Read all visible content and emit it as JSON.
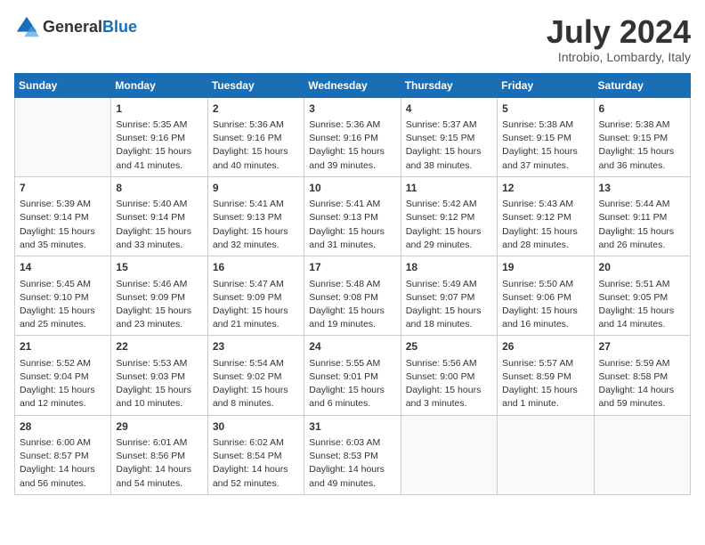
{
  "header": {
    "logo_general": "General",
    "logo_blue": "Blue",
    "month_year": "July 2024",
    "location": "Introbio, Lombardy, Italy"
  },
  "days_of_week": [
    "Sunday",
    "Monday",
    "Tuesday",
    "Wednesday",
    "Thursday",
    "Friday",
    "Saturday"
  ],
  "weeks": [
    [
      {
        "day": "",
        "info": ""
      },
      {
        "day": "1",
        "info": "Sunrise: 5:35 AM\nSunset: 9:16 PM\nDaylight: 15 hours\nand 41 minutes."
      },
      {
        "day": "2",
        "info": "Sunrise: 5:36 AM\nSunset: 9:16 PM\nDaylight: 15 hours\nand 40 minutes."
      },
      {
        "day": "3",
        "info": "Sunrise: 5:36 AM\nSunset: 9:16 PM\nDaylight: 15 hours\nand 39 minutes."
      },
      {
        "day": "4",
        "info": "Sunrise: 5:37 AM\nSunset: 9:15 PM\nDaylight: 15 hours\nand 38 minutes."
      },
      {
        "day": "5",
        "info": "Sunrise: 5:38 AM\nSunset: 9:15 PM\nDaylight: 15 hours\nand 37 minutes."
      },
      {
        "day": "6",
        "info": "Sunrise: 5:38 AM\nSunset: 9:15 PM\nDaylight: 15 hours\nand 36 minutes."
      }
    ],
    [
      {
        "day": "7",
        "info": "Sunrise: 5:39 AM\nSunset: 9:14 PM\nDaylight: 15 hours\nand 35 minutes."
      },
      {
        "day": "8",
        "info": "Sunrise: 5:40 AM\nSunset: 9:14 PM\nDaylight: 15 hours\nand 33 minutes."
      },
      {
        "day": "9",
        "info": "Sunrise: 5:41 AM\nSunset: 9:13 PM\nDaylight: 15 hours\nand 32 minutes."
      },
      {
        "day": "10",
        "info": "Sunrise: 5:41 AM\nSunset: 9:13 PM\nDaylight: 15 hours\nand 31 minutes."
      },
      {
        "day": "11",
        "info": "Sunrise: 5:42 AM\nSunset: 9:12 PM\nDaylight: 15 hours\nand 29 minutes."
      },
      {
        "day": "12",
        "info": "Sunrise: 5:43 AM\nSunset: 9:12 PM\nDaylight: 15 hours\nand 28 minutes."
      },
      {
        "day": "13",
        "info": "Sunrise: 5:44 AM\nSunset: 9:11 PM\nDaylight: 15 hours\nand 26 minutes."
      }
    ],
    [
      {
        "day": "14",
        "info": "Sunrise: 5:45 AM\nSunset: 9:10 PM\nDaylight: 15 hours\nand 25 minutes."
      },
      {
        "day": "15",
        "info": "Sunrise: 5:46 AM\nSunset: 9:09 PM\nDaylight: 15 hours\nand 23 minutes."
      },
      {
        "day": "16",
        "info": "Sunrise: 5:47 AM\nSunset: 9:09 PM\nDaylight: 15 hours\nand 21 minutes."
      },
      {
        "day": "17",
        "info": "Sunrise: 5:48 AM\nSunset: 9:08 PM\nDaylight: 15 hours\nand 19 minutes."
      },
      {
        "day": "18",
        "info": "Sunrise: 5:49 AM\nSunset: 9:07 PM\nDaylight: 15 hours\nand 18 minutes."
      },
      {
        "day": "19",
        "info": "Sunrise: 5:50 AM\nSunset: 9:06 PM\nDaylight: 15 hours\nand 16 minutes."
      },
      {
        "day": "20",
        "info": "Sunrise: 5:51 AM\nSunset: 9:05 PM\nDaylight: 15 hours\nand 14 minutes."
      }
    ],
    [
      {
        "day": "21",
        "info": "Sunrise: 5:52 AM\nSunset: 9:04 PM\nDaylight: 15 hours\nand 12 minutes."
      },
      {
        "day": "22",
        "info": "Sunrise: 5:53 AM\nSunset: 9:03 PM\nDaylight: 15 hours\nand 10 minutes."
      },
      {
        "day": "23",
        "info": "Sunrise: 5:54 AM\nSunset: 9:02 PM\nDaylight: 15 hours\nand 8 minutes."
      },
      {
        "day": "24",
        "info": "Sunrise: 5:55 AM\nSunset: 9:01 PM\nDaylight: 15 hours\nand 6 minutes."
      },
      {
        "day": "25",
        "info": "Sunrise: 5:56 AM\nSunset: 9:00 PM\nDaylight: 15 hours\nand 3 minutes."
      },
      {
        "day": "26",
        "info": "Sunrise: 5:57 AM\nSunset: 8:59 PM\nDaylight: 15 hours\nand 1 minute."
      },
      {
        "day": "27",
        "info": "Sunrise: 5:59 AM\nSunset: 8:58 PM\nDaylight: 14 hours\nand 59 minutes."
      }
    ],
    [
      {
        "day": "28",
        "info": "Sunrise: 6:00 AM\nSunset: 8:57 PM\nDaylight: 14 hours\nand 56 minutes."
      },
      {
        "day": "29",
        "info": "Sunrise: 6:01 AM\nSunset: 8:56 PM\nDaylight: 14 hours\nand 54 minutes."
      },
      {
        "day": "30",
        "info": "Sunrise: 6:02 AM\nSunset: 8:54 PM\nDaylight: 14 hours\nand 52 minutes."
      },
      {
        "day": "31",
        "info": "Sunrise: 6:03 AM\nSunset: 8:53 PM\nDaylight: 14 hours\nand 49 minutes."
      },
      {
        "day": "",
        "info": ""
      },
      {
        "day": "",
        "info": ""
      },
      {
        "day": "",
        "info": ""
      }
    ]
  ]
}
